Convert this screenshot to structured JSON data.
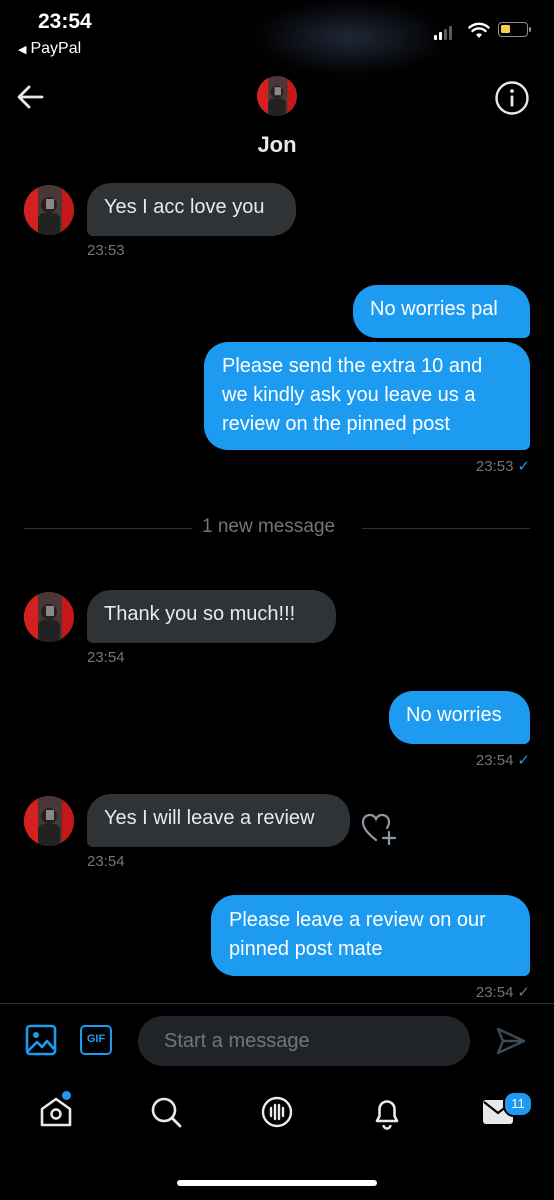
{
  "status_bar": {
    "time": "23:54",
    "back_app": "PayPal"
  },
  "header": {
    "name": "Jon"
  },
  "messages": [
    {
      "text": "Yes I acc love you",
      "time": "23:53"
    },
    {
      "text": "No worries pal"
    },
    {
      "text": "Please send the extra 10 and we kindly ask you leave us a review on the pinned post",
      "time": "23:53"
    },
    {
      "text": "Thank you so much!!!",
      "time": "23:54"
    },
    {
      "text": "No worries",
      "time": "23:54"
    },
    {
      "text": "Yes I will leave a review",
      "time": "23:54"
    },
    {
      "text": "Please leave a review on our pinned post mate",
      "time": "23:54"
    }
  ],
  "divider": "1 new message",
  "composer": {
    "placeholder": "Start a message",
    "gif_label": "GIF"
  },
  "nav": {
    "messages_badge": "11"
  },
  "colors": {
    "accent": "#1d9bf0",
    "incoming_bubble": "#2f3336",
    "background": "#000000"
  }
}
